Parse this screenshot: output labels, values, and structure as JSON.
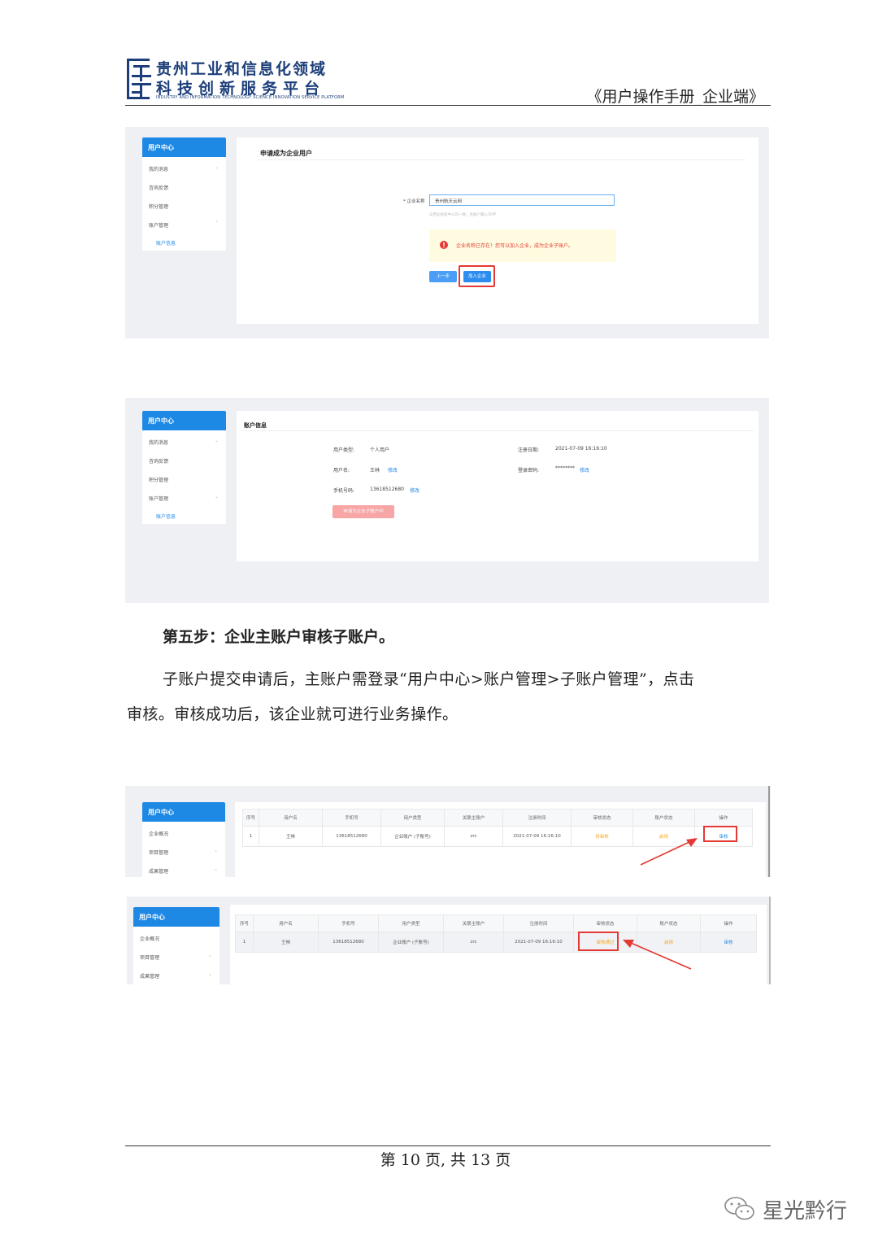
{
  "header": {
    "logo_line1": "贵州工业和信息化领域",
    "logo_line2": "科技创新服务平台",
    "logo_line3": "INDUSTRY AND INFORMATION TECHNOLOGY SCIENCE INNOVATION SERVICE PLATFORM",
    "doc_title": "《用户操作手册_企业端》"
  },
  "shot1": {
    "sidebar": {
      "head": "用户中心",
      "items": [
        "我的消息",
        "咨询反馈",
        "积分管理",
        "账户管理",
        "账户信息"
      ]
    },
    "title": "申请成为企业用户",
    "field_label": "* 企业名称",
    "field_value": "贵州航天云网",
    "field_hint": "与营业执照中公司一致，且账户输入50字",
    "alert": "企业名称已存在！您可以加入企业，成为企业子账户。",
    "btn_prev": "上一步",
    "btn_join": "加入企业"
  },
  "shot2": {
    "sidebar": {
      "head": "用户中心",
      "items": [
        "我的消息",
        "咨询反馈",
        "积分管理",
        "账户管理",
        "账户信息"
      ]
    },
    "title": "账户信息",
    "user_type_label": "用户类型:",
    "user_type_value": "个人用户",
    "reg_date_label": "注册日期:",
    "reg_date_value": "2021-07-09 16:16:10",
    "username_label": "用户名:",
    "username_value": "王林",
    "password_label": "登录密码:",
    "password_value": "********",
    "phone_label": "手机号码:",
    "phone_value": "13618512680",
    "edit": "修改",
    "apply_btn": "申请为企业子账户中"
  },
  "step": {
    "heading": "第五步：企业主账户审核子账户。",
    "para_line1": "子账户提交申请后，主账户需登录“用户中心>账户管理>子账户管理”，点击",
    "para_line2": "审核。审核成功后，该企业就可进行业务操作。"
  },
  "table_columns": [
    "序号",
    "用户名",
    "手机号",
    "用户类型",
    "关联主账户",
    "注册时间",
    "审核状态",
    "账户状态",
    "操作"
  ],
  "shot3": {
    "sidebar": {
      "head": "用户中心",
      "items": [
        "企业概况",
        "项目管理",
        "成果管理"
      ]
    },
    "row": [
      "1",
      "王林",
      "13618512680",
      "企业账户 (子账号)",
      "zrc",
      "2021-07-09 16:16:10",
      "待审核",
      "启用",
      "审核"
    ]
  },
  "shot4": {
    "sidebar": {
      "head": "用户中心",
      "items": [
        "企业概况",
        "项目管理",
        "成果管理"
      ]
    },
    "row": [
      "1",
      "王林",
      "13618512680",
      "企业账户 (子账号)",
      "zrc",
      "2021-07-09 16:16:10",
      "审核通过",
      "启用",
      "审核"
    ]
  },
  "footer": {
    "page_text": "第 10 页, 共 13 页",
    "watermark": "星光黔行"
  },
  "colors": {
    "brand_blue": "#1e88e5",
    "alert_red": "#e53935",
    "highlight_red": "#e53935",
    "status_orange": "#f5a623"
  }
}
